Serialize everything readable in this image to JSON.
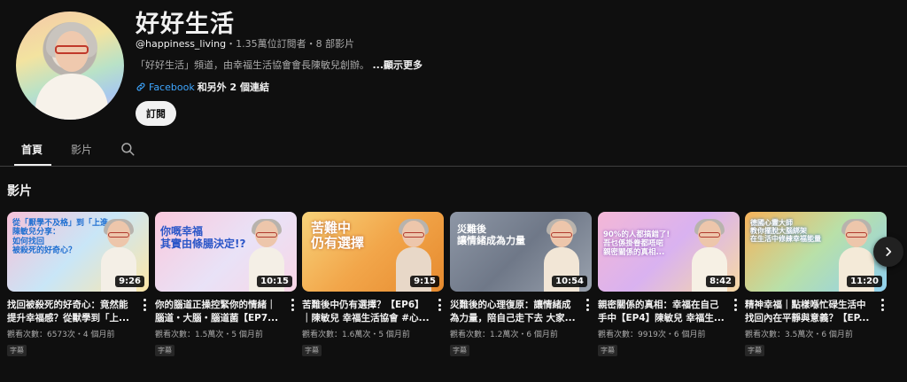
{
  "channel": {
    "title": "好好生活",
    "handle": "@happiness_living",
    "stats": "・1.35萬位訂閱者・8 部影片",
    "description": "「好好生活」頻道，由幸福生活協會會長陳敏兒創辦。",
    "more_label": "...顯示更多",
    "link_label": "Facebook",
    "other_links": "和另外 2 個連結",
    "subscribe_label": "訂閱"
  },
  "tabs": [
    {
      "label": "首頁",
      "active": true
    },
    {
      "label": "影片",
      "active": false
    }
  ],
  "section": {
    "title": "影片"
  },
  "videos": [
    {
      "title": "找回被殺死的好奇心：竟然能提升幸福感？從獸學到「上...",
      "meta": "觀看次數：6573次・4 個月前",
      "badge": "字幕",
      "duration": "9:26",
      "overlay": "從「厭學不及格」到「上進」\n陳敏兒分享：\n如何找回\n被殺死的好奇心？",
      "bg": "linear-gradient(135deg,#f6c1d8 0%,#c9e6f7 50%,#fde7a8 100%)",
      "overlay_color": "#1f6fd1"
    },
    {
      "title": "你的腦道正操控緊你的情緒｜腦道・大腦・腦道菌【EP7...",
      "meta": "觀看次數：1.5萬次・5 個月前",
      "badge": "字幕",
      "duration": "10:15",
      "overlay": "你嘅幸福\n其實由條腸決定!?",
      "bg": "linear-gradient(135deg,#f9c9dd 0%,#e9e2f7 55%,#f8d6e6 100%)",
      "overlay_color": "#2b56c8"
    },
    {
      "title": "苦難後中仍有選擇？【EP6】｜陳敏兒 幸福生活協會 #心...",
      "meta": "觀看次數：1.6萬次・5 個月前",
      "badge": "字幕",
      "duration": "9:15",
      "overlay": "苦難中\n仍有選擇",
      "bg": "linear-gradient(135deg,#f7d27a 0%,#f2a64a 50%,#e68a2e 100%)",
      "overlay_color": "#ffffff"
    },
    {
      "title": "災難後的心理復原：讓情緒成為力量，陪自己走下去 大家...",
      "meta": "觀看次數：1.2萬次・6 個月前",
      "badge": "字幕",
      "duration": "10:54",
      "overlay": "災難後\n讓情緒成為力量",
      "bg": "linear-gradient(135deg,#8e97a6 0%,#6f7888 50%,#9aa2ae 100%)",
      "overlay_color": "#ffffff"
    },
    {
      "title": "親密關係的真相：幸福在自己手中【EP4】陳敏兒 幸福生...",
      "meta": "觀看次數：9919次・6 個月前",
      "badge": "字幕",
      "duration": "8:42",
      "overlay": "90%的人都搞錯了!\n吾乜係掛眷都唔啱\n親密關係的真相...",
      "bg": "linear-gradient(135deg,#f4b7d6 0%,#d9b2f0 50%,#f7d9a3 100%)",
      "overlay_color": "#ffffff"
    },
    {
      "title": "精神幸福｜點樣喺忙碌生活中找回內在平靜與意義？【EP...",
      "meta": "觀看次數：3.5萬次・6 個月前",
      "badge": "字幕",
      "duration": "11:20",
      "overlay": "德國心靈大師\n教你擺脫大腦綁架\n在生活中修練幸福能量",
      "bg": "linear-gradient(135deg,#f6b25a 0%,#b9e0a8 50%,#8fd0f0 100%)",
      "overlay_color": "#ffffff"
    }
  ],
  "icons": {
    "search": "search-icon",
    "link": "link-icon",
    "next": "chevron-right-icon",
    "kebab": "more-vertical-icon"
  },
  "colors": {
    "background": "#0f0f0f",
    "link": "#3ea6ff",
    "text_secondary": "#aaaaaa"
  }
}
